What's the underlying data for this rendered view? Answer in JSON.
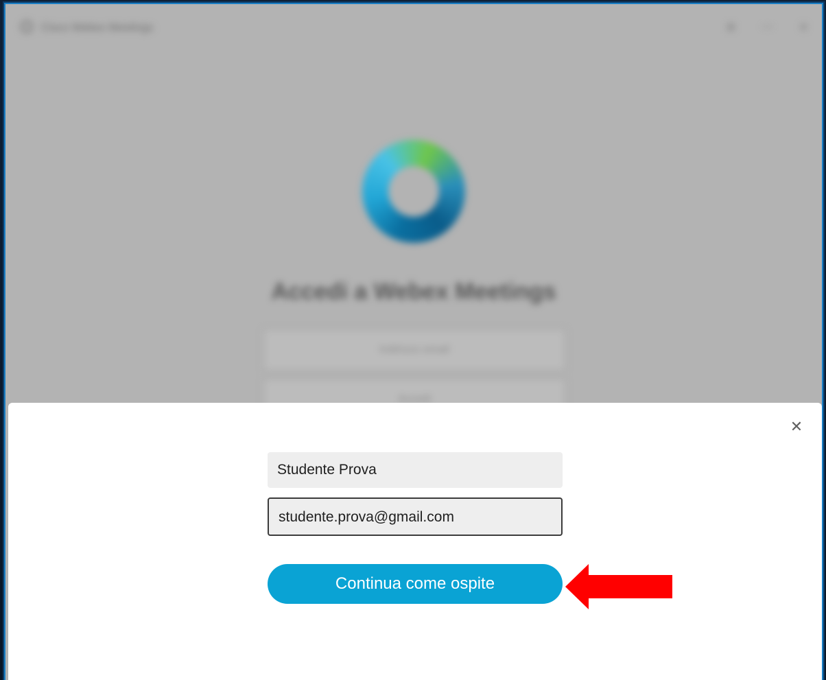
{
  "window": {
    "title": "Cisco Webex Meetings",
    "controls": [
      "⚙",
      "—",
      "✕"
    ]
  },
  "background": {
    "heading": "Accedi a Webex Meetings",
    "field_1": "Indirizzo email",
    "field_2": "Accedi"
  },
  "dialog": {
    "close_icon": "close-icon",
    "name_value": "Studente Prova",
    "email_value": "studente.prova@gmail.com",
    "continue_label": "Continua come ospite"
  },
  "annotation": {
    "arrow_color": "#ff0000",
    "arrow_icon": "left-arrow-icon"
  },
  "colors": {
    "accent": "#0aa3d4",
    "window_border": "#1b7fc4"
  }
}
